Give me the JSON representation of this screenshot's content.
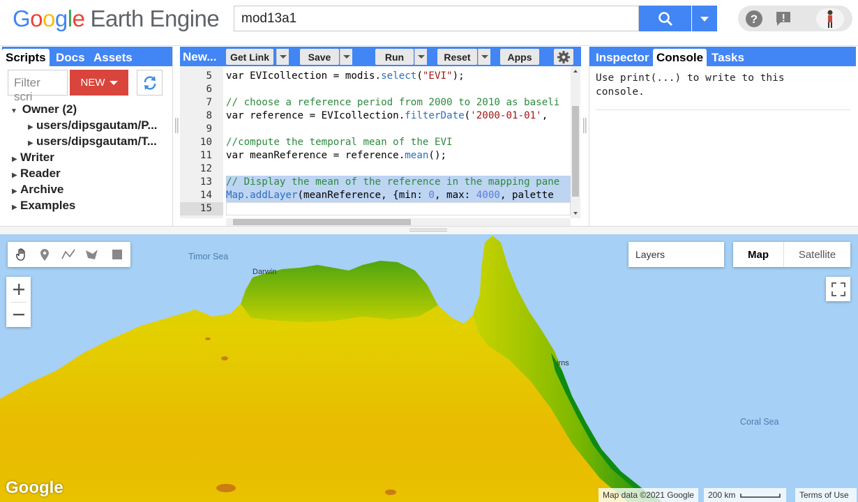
{
  "header": {
    "logo_google": [
      "G",
      "o",
      "o",
      "g",
      "l",
      "e"
    ],
    "logo_product": "Earth Engine",
    "search_value": "mod13a1"
  },
  "left_panel": {
    "tabs": [
      {
        "label": "Scripts"
      },
      {
        "label": "Docs"
      },
      {
        "label": "Assets"
      }
    ],
    "filter_placeholder": "Filter scri",
    "new_label": "NEW",
    "tree": [
      {
        "label": "Owner (2)",
        "expanded": true
      },
      {
        "label": "users/dipsgautam/P..."
      },
      {
        "label": "users/dipsgautam/T..."
      },
      {
        "label": "Writer"
      },
      {
        "label": "Reader"
      },
      {
        "label": "Archive"
      },
      {
        "label": "Examples"
      }
    ]
  },
  "editor": {
    "new_label": "New...",
    "buttons": {
      "get_link": "Get Link",
      "save": "Save",
      "run": "Run",
      "reset": "Reset",
      "apps": "Apps"
    },
    "line_numbers": [
      "5",
      "6",
      "7",
      "8",
      "9",
      "10",
      "11",
      "12",
      "13",
      "14",
      "15"
    ],
    "code": {
      "l5": [
        "var EVIcollection = modis.",
        "select",
        "(",
        "\"EVI\"",
        ");"
      ],
      "l7": "// choose a reference period from 2000 to 2010 as baseli",
      "l8": [
        "var reference = EVIcollection.",
        "filterDate",
        "(",
        "'2000-01-01'",
        ","
      ],
      "l10": "//compute the temporal mean of the EVI",
      "l11": [
        "var meanReference = reference.",
        "mean",
        "();"
      ],
      "l13": "// Display the mean of the reference in the mapping pane",
      "l14": [
        "Map.addLayer",
        "(meanReference, {min: ",
        "0",
        ", max: ",
        "4000",
        ", palette"
      ]
    }
  },
  "console_panel": {
    "tabs": [
      {
        "label": "Inspector"
      },
      {
        "label": "Console"
      },
      {
        "label": "Tasks"
      }
    ],
    "message_line1": "Use print(...) to write to this",
    "message_line2": "console."
  },
  "map": {
    "layers_label": "Layers",
    "map_type": {
      "map": "Map",
      "satellite": "Satellite"
    },
    "labels": {
      "timor_sea": "Timor Sea",
      "coral_sea": "Coral Sea",
      "darwin": "Darwin",
      "cairns": "irns"
    },
    "watermark": "Google",
    "attribution": "Map data ©2021 Google",
    "scale": "200 km",
    "terms": "Terms of Use",
    "colors": {
      "water": "#a6d0f5",
      "low_evi": "#e8c800",
      "high_evi": "#0e8a10"
    }
  }
}
